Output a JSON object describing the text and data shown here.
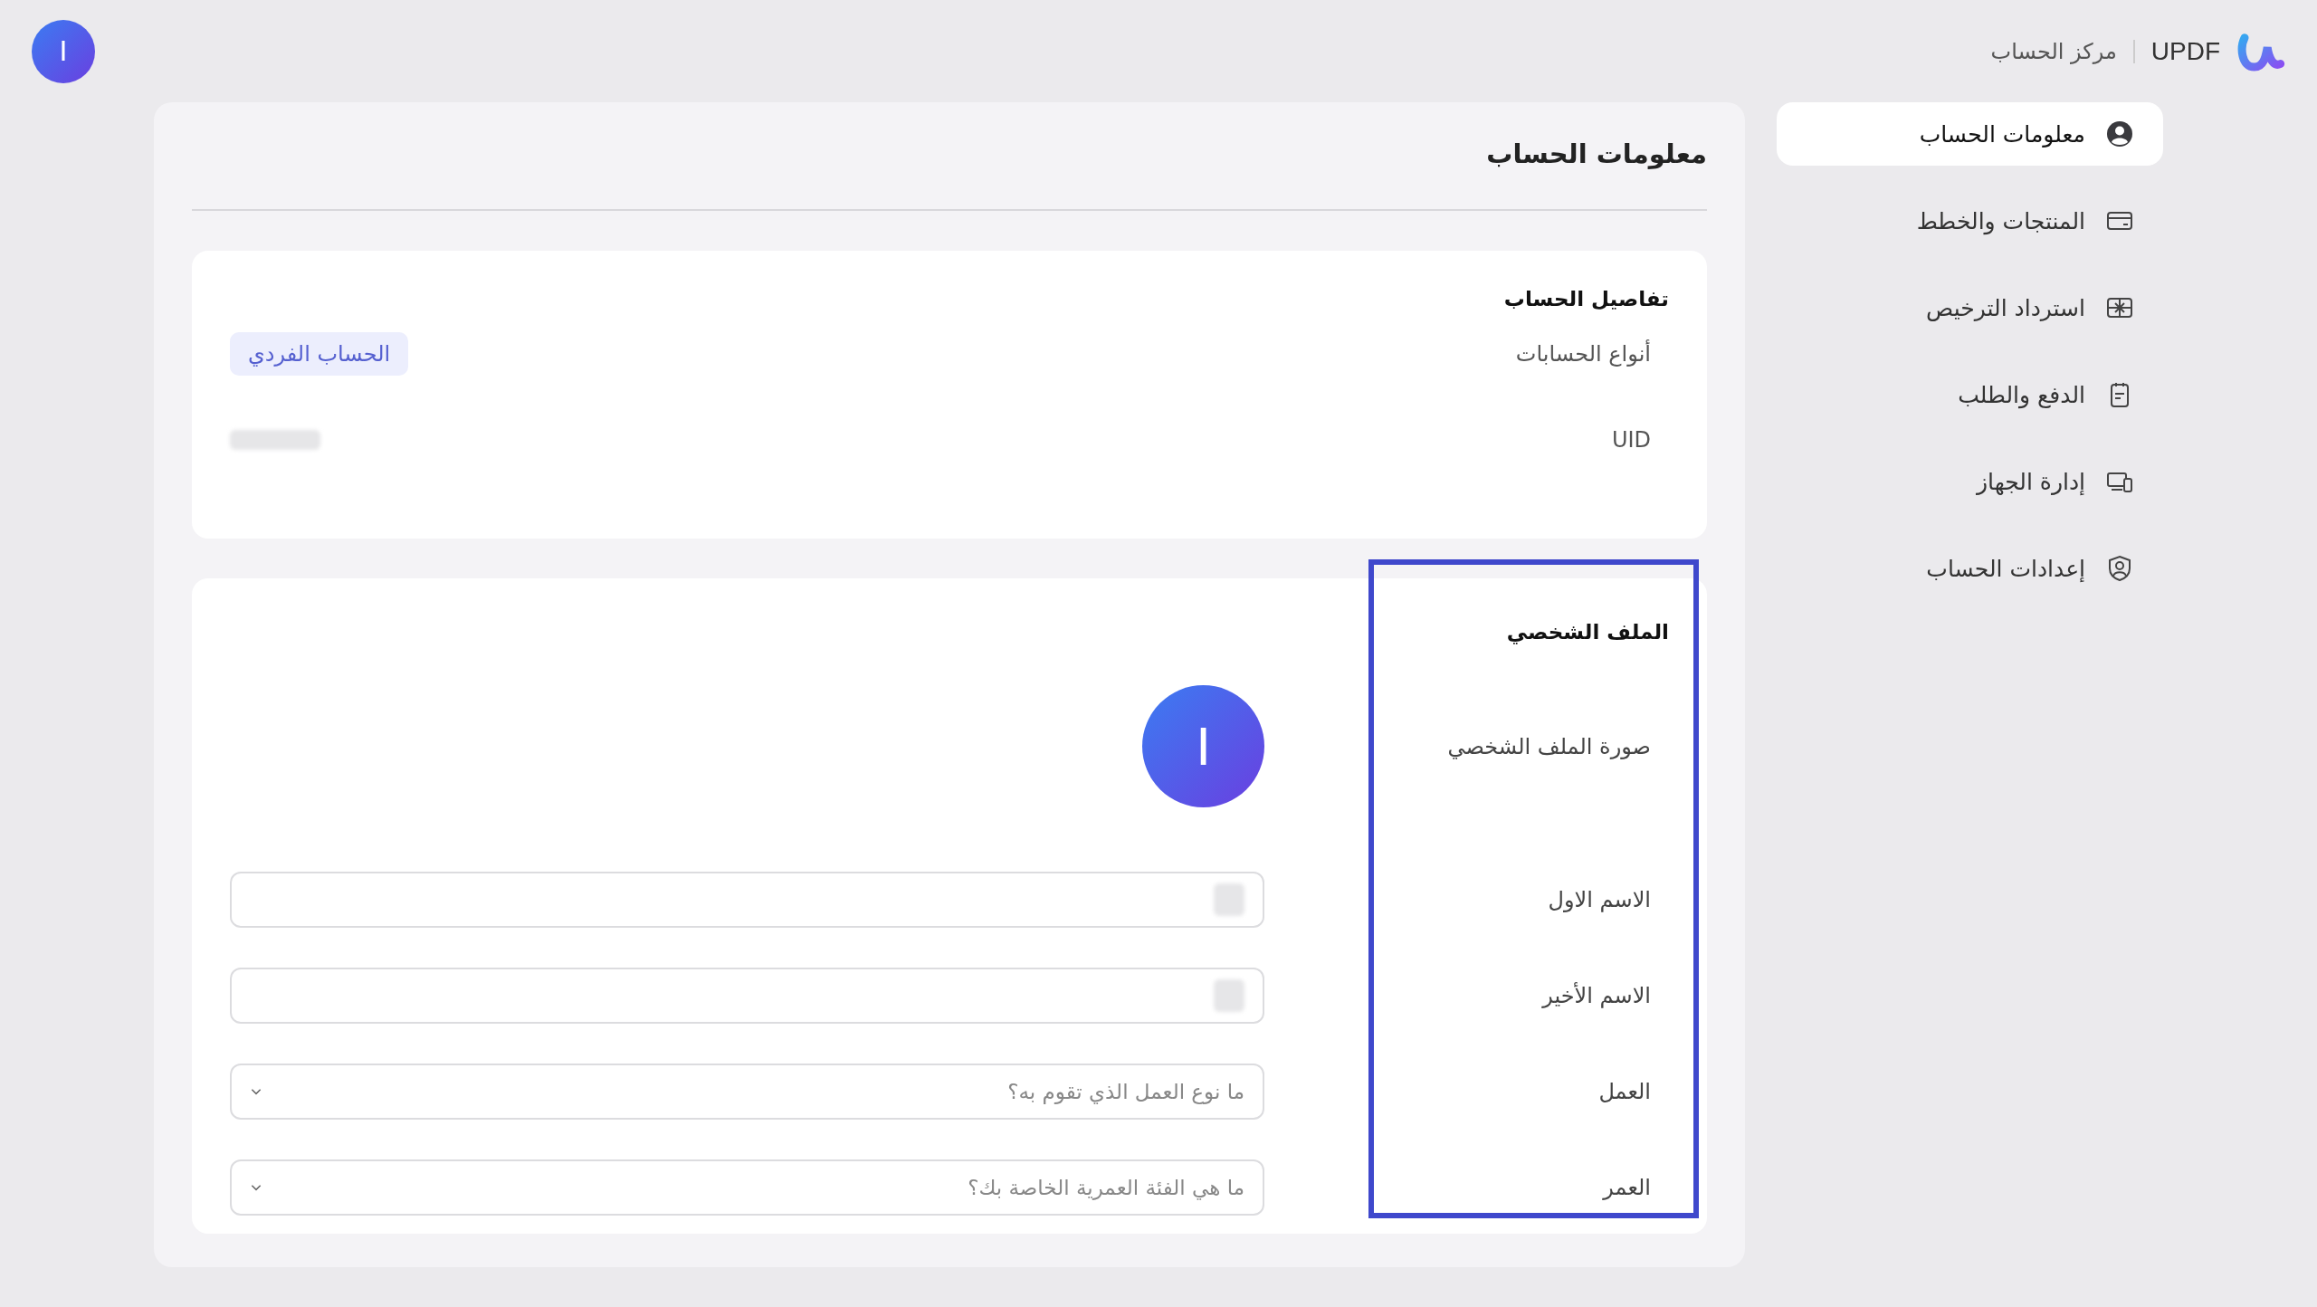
{
  "header": {
    "avatar_initial": "I",
    "brand": "UPDF",
    "section": "مركز الحساب"
  },
  "sidebar": {
    "items": [
      {
        "label": "معلومات الحساب",
        "selected": true,
        "kind": "user"
      },
      {
        "label": "المنتجات والخطط",
        "selected": false,
        "kind": "card"
      },
      {
        "label": "استرداد الترخيص",
        "selected": false,
        "kind": "gift"
      },
      {
        "label": "الدفع والطلب",
        "selected": false,
        "kind": "clipboard"
      },
      {
        "label": "إدارة الجهاز",
        "selected": false,
        "kind": "devices"
      },
      {
        "label": "إعدادات الحساب",
        "selected": false,
        "kind": "shield"
      }
    ]
  },
  "page_title": "معلومات الحساب",
  "details": {
    "title": "تفاصيل الحساب",
    "rows": [
      {
        "label": "أنواع الحسابات",
        "badge": "الحساب الفردي"
      },
      {
        "label": "UID"
      }
    ]
  },
  "profile": {
    "title": "الملف الشخصي",
    "highlighted": true,
    "picture_label": "صورة الملف الشخصي",
    "avatar_initial": "I",
    "fields": [
      {
        "label": "الاسم الاول",
        "kind": "text"
      },
      {
        "label": "الاسم الأخير",
        "kind": "text"
      },
      {
        "label": "العمل",
        "kind": "select",
        "placeholder": "ما نوع العمل الذي تقوم به؟"
      },
      {
        "label": "العمر",
        "kind": "select",
        "placeholder": "ما هي الفئة العمرية الخاصة بك؟"
      }
    ]
  }
}
